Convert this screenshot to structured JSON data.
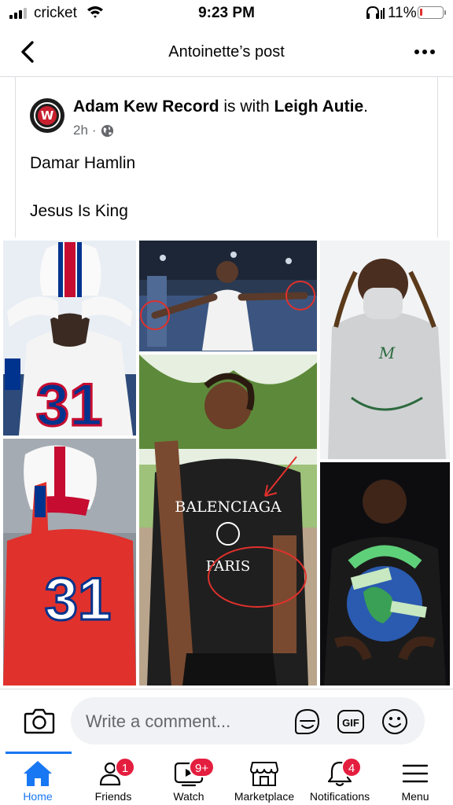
{
  "status_bar": {
    "carrier": "cricket",
    "time": "9:23 PM",
    "battery_percent": "11%",
    "battery_level": 0.11
  },
  "header": {
    "title": "Antoinette’s post"
  },
  "post": {
    "author": "Adam Kew Record",
    "with_text": "is with",
    "tagged": "Leigh Autie",
    "age": "2h",
    "separator": "·",
    "line1": "Damar Hamlin",
    "line2": "Jesus Is King",
    "photos": [
      {
        "jersey_number": "31",
        "jersey_color": "#ffffff"
      },
      {
        "jersey_number": "",
        "jersey_color": "#ffffff"
      },
      {
        "jersey_number": "",
        "jersey_color": "#d9d9d9"
      },
      {
        "jersey_number": "31",
        "jersey_color": "#e0312c"
      },
      {
        "jersey_number": "",
        "jersey_color": "#1f1f1f"
      },
      {
        "jersey_number": "",
        "jersey_color": "#1c4f2a"
      }
    ]
  },
  "comment_bar": {
    "placeholder": "Write a comment..."
  },
  "tabs": [
    {
      "label": "Home",
      "icon": "home-icon",
      "badge": ""
    },
    {
      "label": "Friends",
      "icon": "friends-icon",
      "badge": "1"
    },
    {
      "label": "Watch",
      "icon": "watch-icon",
      "badge": "9+"
    },
    {
      "label": "Marketplace",
      "icon": "marketplace-icon",
      "badge": ""
    },
    {
      "label": "Notifications",
      "icon": "bell-icon",
      "badge": "4"
    },
    {
      "label": "Menu",
      "icon": "menu-icon",
      "badge": ""
    }
  ],
  "colors": {
    "accent": "#1877f2",
    "badge": "#e41e3f",
    "bills_blue": "#00338d",
    "bills_red": "#c60c30"
  }
}
